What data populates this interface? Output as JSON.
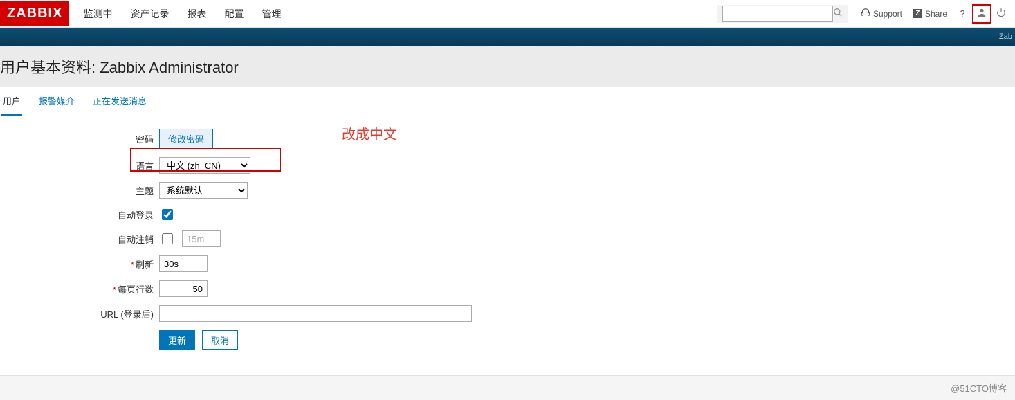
{
  "brand": "ZABBIX",
  "nav": {
    "items": [
      "监测中",
      "资产记录",
      "报表",
      "配置",
      "管理"
    ]
  },
  "top": {
    "search_placeholder": "",
    "support": "Support",
    "share": "Share",
    "help": "?",
    "subbar_right": "Zab"
  },
  "page": {
    "title_prefix": "用户基本资料: ",
    "title_user": "Zabbix Administrator"
  },
  "tabs": {
    "user": "用户",
    "media": "报警媒介",
    "messaging": "正在发送消息"
  },
  "labels": {
    "password": "密码",
    "language": "语言",
    "theme": "主题",
    "auto_login": "自动登录",
    "auto_logout": "自动注销",
    "refresh": "刷新",
    "rows": "每页行数",
    "url": "URL (登录后)"
  },
  "values": {
    "change_password_btn": "修改密码",
    "language_selected": "中文 (zh_CN)",
    "theme_selected": "系统默认",
    "auto_login_checked": true,
    "auto_logout_checked": false,
    "auto_logout_value": "15m",
    "refresh": "30s",
    "rows": "50",
    "url": ""
  },
  "buttons": {
    "update": "更新",
    "cancel": "取消"
  },
  "annotation": "改成中文",
  "footer": "@51CTO博客"
}
